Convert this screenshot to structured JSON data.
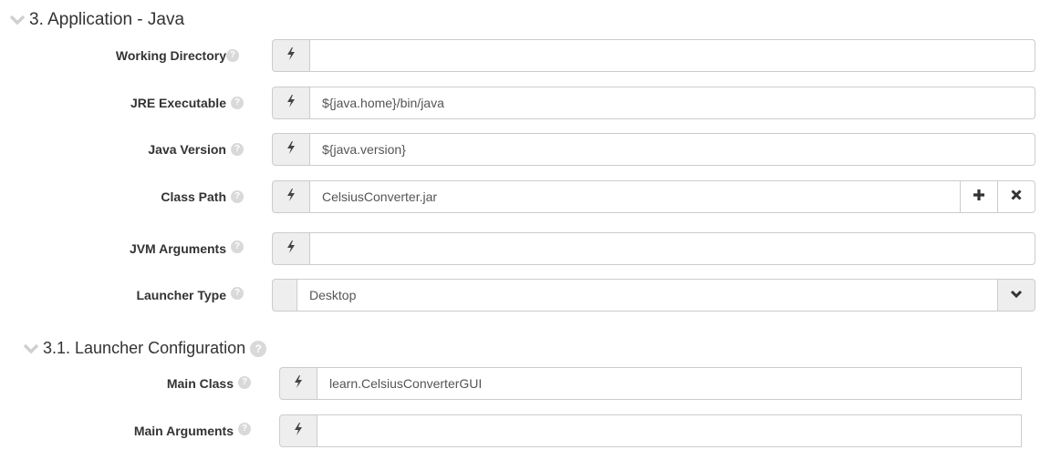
{
  "section": {
    "title": "3. Application - Java",
    "fields": [
      {
        "label": "Working Directory",
        "value": ""
      },
      {
        "label": "JRE Executable",
        "value": "${java.home}/bin/java"
      },
      {
        "label": "Java Version",
        "value": "${java.version}"
      },
      {
        "label": "Class Path",
        "value": "CelsiusConverter.jar"
      },
      {
        "label": "JVM Arguments",
        "value": ""
      },
      {
        "label": "Launcher Type",
        "value": "Desktop"
      }
    ]
  },
  "subsection": {
    "title": "3.1. Launcher Configuration",
    "fields": [
      {
        "label": "Main Class",
        "value": "learn.CelsiusConverterGUI"
      },
      {
        "label": "Main Arguments",
        "value": ""
      }
    ]
  },
  "help_glyph": "?",
  "icons": {
    "chevron": "chevron-down-icon",
    "bolt": "bolt-icon",
    "plus": "plus-icon",
    "remove": "times-icon",
    "select": "chevron-down-icon"
  }
}
